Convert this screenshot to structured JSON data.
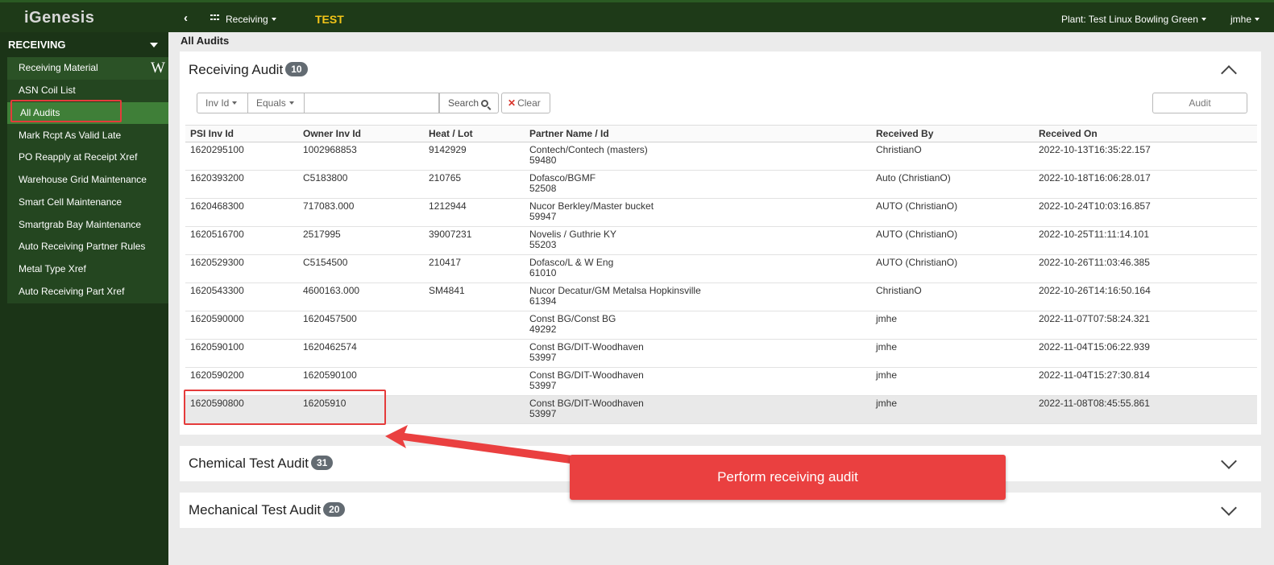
{
  "topbar": {
    "logo": "iGenesis",
    "back_icon": "‹",
    "module": "Receiving",
    "env": "TEST",
    "plant": "Plant: Test Linux Bowling Green",
    "user": "jmhe"
  },
  "sidebar": {
    "heading": "RECEIVING",
    "wiki_icon": "W",
    "items": [
      {
        "label": "Receiving Material"
      },
      {
        "label": "ASN Coil List"
      },
      {
        "label": "All Audits"
      },
      {
        "label": "Mark Rcpt As Valid Late"
      },
      {
        "label": "PO Reapply at Receipt Xref"
      },
      {
        "label": "Warehouse Grid Maintenance"
      },
      {
        "label": "Smart Cell Maintenance"
      },
      {
        "label": "Smartgrab Bay Maintenance"
      },
      {
        "label": "Auto Receiving Partner Rules"
      },
      {
        "label": "Metal Type Xref"
      },
      {
        "label": "Auto Receiving Part Xref"
      }
    ]
  },
  "breadcrumb": "All Audits",
  "receiving_audit": {
    "title": "Receiving Audit",
    "count": "10",
    "filter": {
      "field": "Inv Id",
      "operator": "Equals",
      "value": "",
      "search_label": "Search",
      "clear_label": "Clear"
    },
    "audit_button": "Audit",
    "columns": [
      "PSI Inv Id",
      "Owner Inv Id",
      "Heat / Lot",
      "Partner Name / Id",
      "Received By",
      "Received On"
    ],
    "rows": [
      {
        "psi": "1620295100",
        "owner": "1002968853",
        "heat": "9142929",
        "partner": "Contech/Contech (masters)",
        "partner_id": "59480",
        "by": "ChristianO",
        "on": "2022-10-13T16:35:22.157"
      },
      {
        "psi": "1620393200",
        "owner": "C5183800",
        "heat": "210765",
        "partner": "Dofasco/BGMF",
        "partner_id": "52508",
        "by": "Auto (ChristianO)",
        "on": "2022-10-18T16:06:28.017"
      },
      {
        "psi": "1620468300",
        "owner": "717083.000",
        "heat": "1212944",
        "partner": "Nucor Berkley/Master bucket",
        "partner_id": "59947",
        "by": "AUTO (ChristianO)",
        "on": "2022-10-24T10:03:16.857"
      },
      {
        "psi": "1620516700",
        "owner": "2517995",
        "heat": "39007231",
        "partner": "Novelis / Guthrie KY",
        "partner_id": "55203",
        "by": "AUTO (ChristianO)",
        "on": "2022-10-25T11:11:14.101"
      },
      {
        "psi": "1620529300",
        "owner": "C5154500",
        "heat": "210417",
        "partner": "Dofasco/L & W Eng",
        "partner_id": "61010",
        "by": "AUTO (ChristianO)",
        "on": "2022-10-26T11:03:46.385"
      },
      {
        "psi": "1620543300",
        "owner": "4600163.000",
        "heat": "SM4841",
        "partner": "Nucor Decatur/GM Metalsa Hopkinsville",
        "partner_id": "61394",
        "by": "ChristianO",
        "on": "2022-10-26T14:16:50.164"
      },
      {
        "psi": "1620590000",
        "owner": "1620457500",
        "heat": "",
        "partner": "Const BG/Const BG",
        "partner_id": "49292",
        "by": "jmhe",
        "on": "2022-11-07T07:58:24.321"
      },
      {
        "psi": "1620590100",
        "owner": "1620462574",
        "heat": "",
        "partner": "Const BG/DIT-Woodhaven",
        "partner_id": "53997",
        "by": "jmhe",
        "on": "2022-11-04T15:06:22.939"
      },
      {
        "psi": "1620590200",
        "owner": "1620590100",
        "heat": "",
        "partner": "Const BG/DIT-Woodhaven",
        "partner_id": "53997",
        "by": "jmhe",
        "on": "2022-11-04T15:27:30.814"
      },
      {
        "psi": "1620590800",
        "owner": "16205910",
        "heat": "",
        "partner": "Const BG/DIT-Woodhaven",
        "partner_id": "53997",
        "by": "jmhe",
        "on": "2022-11-08T08:45:55.861"
      }
    ]
  },
  "chemical_audit": {
    "title": "Chemical Test Audit",
    "count": "31"
  },
  "mechanical_audit": {
    "title": "Mechanical Test Audit",
    "count": "20"
  },
  "callout": {
    "text": "Perform receiving audit",
    "color": "#ea4040"
  }
}
